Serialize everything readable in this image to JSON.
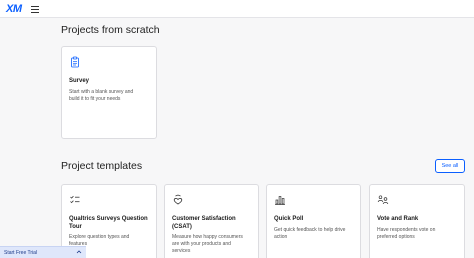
{
  "header": {
    "logo_text": "XM",
    "menu_icon": "hamburger-menu-icon"
  },
  "scratch_section": {
    "title": "Projects from scratch",
    "cards": [
      {
        "icon": "clipboard-icon",
        "title": "Survey",
        "desc_line1": "Start with a blank survey and",
        "desc_line2": "build it to fit your needs"
      }
    ]
  },
  "templates_section": {
    "title": "Project templates",
    "see_all_label": "See all",
    "cards": [
      {
        "icon": "checklist-icon",
        "title_line1": "Qualtrics Surveys Question",
        "title_line2": "Tour",
        "desc_line1": "Explore question types and",
        "desc_line2": "features"
      },
      {
        "icon": "heart-hand-icon",
        "title_line1": "Customer Satisfaction",
        "title_line2": "(CSAT)",
        "desc_line1": "Measure how happy consumers",
        "desc_line2": "are with your products and",
        "desc_line3": "services"
      },
      {
        "icon": "bar-chart-icon",
        "title_line1": "Quick Poll",
        "desc_line1": "Get quick feedback to help drive",
        "desc_line2": "action"
      },
      {
        "icon": "people-vote-icon",
        "title_line1": "Vote and Rank",
        "desc_line1": "Have respondents vote on",
        "desc_line2": "preferred options"
      }
    ]
  },
  "trial_bar": {
    "label": "Start Free Trial",
    "chevron_icon": "chevron-up-icon"
  },
  "colors": {
    "accent": "#0b5fff",
    "background": "#f7f7f8",
    "card_border": "#dcdce0",
    "trial_bar": "#dfe7fb"
  }
}
